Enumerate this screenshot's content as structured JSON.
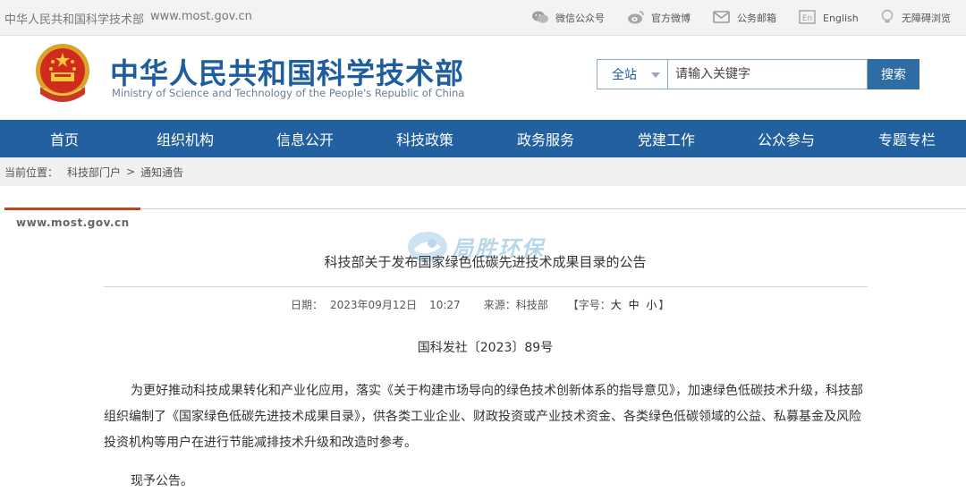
{
  "topbar": {
    "site_name": "中华人民共和国科学技术部",
    "domain": "www.most.gov.cn",
    "links": [
      {
        "label": "微信公众号",
        "icon": "wechat-icon"
      },
      {
        "label": "官方微博",
        "icon": "weibo-icon"
      },
      {
        "label": "公务邮箱",
        "icon": "mail-icon"
      },
      {
        "label": "English",
        "icon": "en-icon"
      },
      {
        "label": "无障碍浏览",
        "icon": "bulb-icon"
      }
    ]
  },
  "header": {
    "title_cn": "中华人民共和国科学技术部",
    "title_en": "Ministry of Science and Technology of the People's Republic of China",
    "logo": "national-emblem-icon"
  },
  "search": {
    "scope": "全站",
    "placeholder": "请输入关键字",
    "button": "搜索"
  },
  "nav": [
    "首页",
    "组织机构",
    "信息公开",
    "科技政策",
    "政务服务",
    "党建工作",
    "公众参与",
    "专题专栏"
  ],
  "breadcrumb": {
    "prefix": "当前位置：",
    "items": [
      "科技部门户",
      ">",
      "通知通告"
    ]
  },
  "watermark": {
    "domain": "www.most.gov.cn",
    "brand": "局胜环保"
  },
  "article": {
    "title": "科技部关于发布国家绿色低碳先进技术成果目录的公告",
    "date_label": "日期：",
    "date": "2023年09月12日",
    "time": "10:27",
    "source_label": "来源：",
    "source": "科技部",
    "font_size_label": "【字号：",
    "font_size_options": "大 中 小",
    "font_size_close": "】",
    "doc_number": "国科发社〔2023〕89号",
    "paragraph1": "为更好推动科技成果转化和产业化应用，落实《关于构建市场导向的绿色技术创新体系的指导意见》，加速绿色低碳技术升级，科技部组织编制了《国家绿色低碳先进技术成果目录》，供各类工业企业、财政投资或产业技术资金、各类绿色低碳领域的公益、私募基金及风险投资机构等用户在进行节能减排技术升级和改造时参考。",
    "paragraph2": "现予公告。"
  },
  "colors": {
    "brand_blue": "#1d5da0",
    "nav_blue": "#22609f",
    "accent_red": "#b54a1e"
  }
}
